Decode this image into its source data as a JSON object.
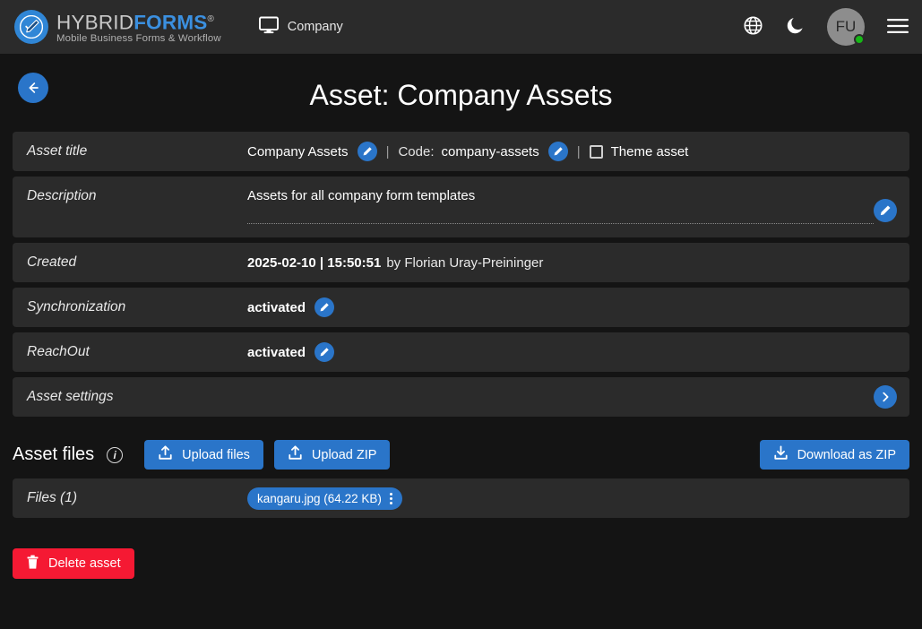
{
  "header": {
    "logo": {
      "title_light": "HYBRID",
      "title_bold": "FORMS",
      "registered": "®",
      "tagline": "Mobile Business Forms & Workflow"
    },
    "context_label": "Company",
    "icons": {
      "monitor": "monitor-icon",
      "language": "globe-icon",
      "theme": "moon-icon",
      "menu": "hamburger-menu-icon"
    },
    "avatar_initials": "FU"
  },
  "page": {
    "title": "Asset: Company Assets",
    "back_label": "Back"
  },
  "fields": {
    "asset_title": {
      "label": "Asset title",
      "value": "Company Assets",
      "code_label": "Code:",
      "code_value": "company-assets",
      "separator": "|",
      "theme_asset_label": "Theme asset",
      "theme_asset_checked": false
    },
    "description": {
      "label": "Description",
      "value": "Assets for all company form templates"
    },
    "created": {
      "label": "Created",
      "datetime": "2025-02-10 | 15:50:51",
      "by": "by Florian Uray-Preininger"
    },
    "synchronization": {
      "label": "Synchronization",
      "value": "activated"
    },
    "reachout": {
      "label": "ReachOut",
      "value": "activated"
    },
    "asset_settings": {
      "label": "Asset settings"
    }
  },
  "asset_files": {
    "title": "Asset files",
    "info_glyph": "i",
    "upload_files_label": "Upload files",
    "upload_zip_label": "Upload ZIP",
    "download_zip_label": "Download as ZIP",
    "files_label": "Files (1)",
    "files": [
      {
        "name": "kangaru.jpg (64.22 KB)"
      }
    ]
  },
  "actions": {
    "delete_label": "Delete asset"
  },
  "colors": {
    "accent": "#2a75c9",
    "danger": "#f51933",
    "row_bg": "#2b2b2b",
    "page_bg": "#141414",
    "status_online": "#16b616"
  }
}
